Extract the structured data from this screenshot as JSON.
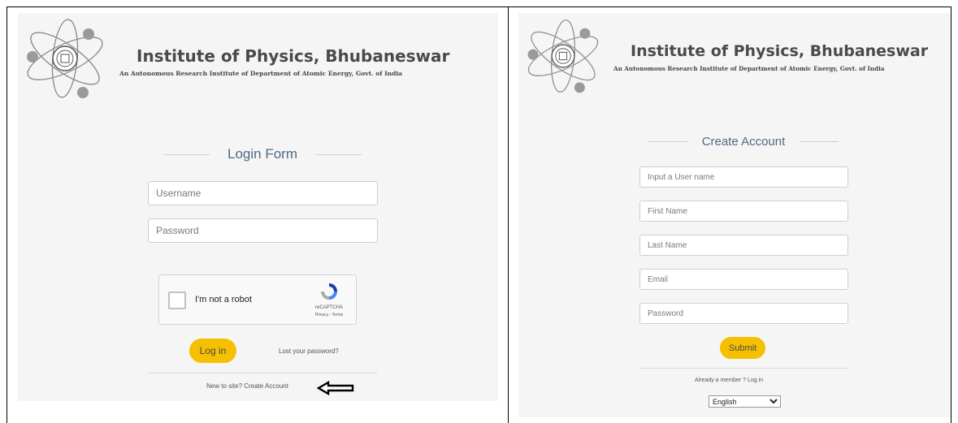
{
  "login": {
    "brand_title": "Institute of Physics, Bhubaneswar",
    "brand_subtitle": "An Autonomous Research Institute of Department of Atomic Energy, Govt. of India",
    "heading": "Login Form",
    "username_placeholder": "Username",
    "password_placeholder": "Password",
    "captcha_label": "I'm not a robot",
    "captcha_brand": "reCAPTCHA",
    "captcha_links": "Privacy - Terms",
    "login_button": "Log in",
    "lost_password_link": "Lost your password?",
    "create_account_link": "New to site? Create Account"
  },
  "signup": {
    "brand_title": "Institute of Physics, Bhubaneswar",
    "brand_subtitle": "An Autonomous Research Institute of Department of Atomic Energy, Govt. of India",
    "heading": "Create Account",
    "username_placeholder": "Input a User name",
    "first_name_placeholder": "First Name",
    "last_name_placeholder": "Last Name",
    "email_placeholder": "Email",
    "password_placeholder": "Password",
    "submit_button": "Submit",
    "login_link": "Already a member ? Log in",
    "language_selected": "English"
  },
  "colors": {
    "accent": "#f5c000",
    "heading": "#4d6a85",
    "panel_bg": "#f5f5f5"
  }
}
